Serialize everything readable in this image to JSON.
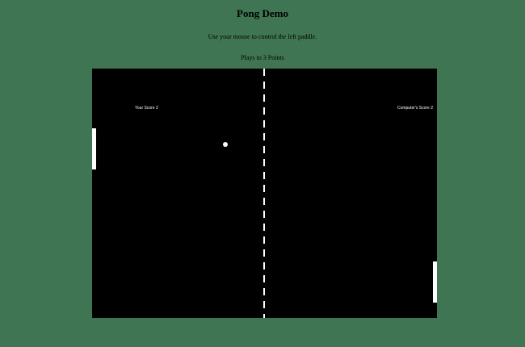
{
  "page": {
    "title": "Pong Demo",
    "instructions": "Use your mouse to control the left paddle.",
    "plays_to": "Plays to 3 Points",
    "background_color": "#3f7552"
  },
  "game": {
    "background_color": "#000000",
    "foreground_color": "#ffffff",
    "player_score": {
      "label": "Your Score 2",
      "value": 2
    },
    "computer_score": {
      "label": "Computer's Score 2",
      "value": 2
    }
  }
}
